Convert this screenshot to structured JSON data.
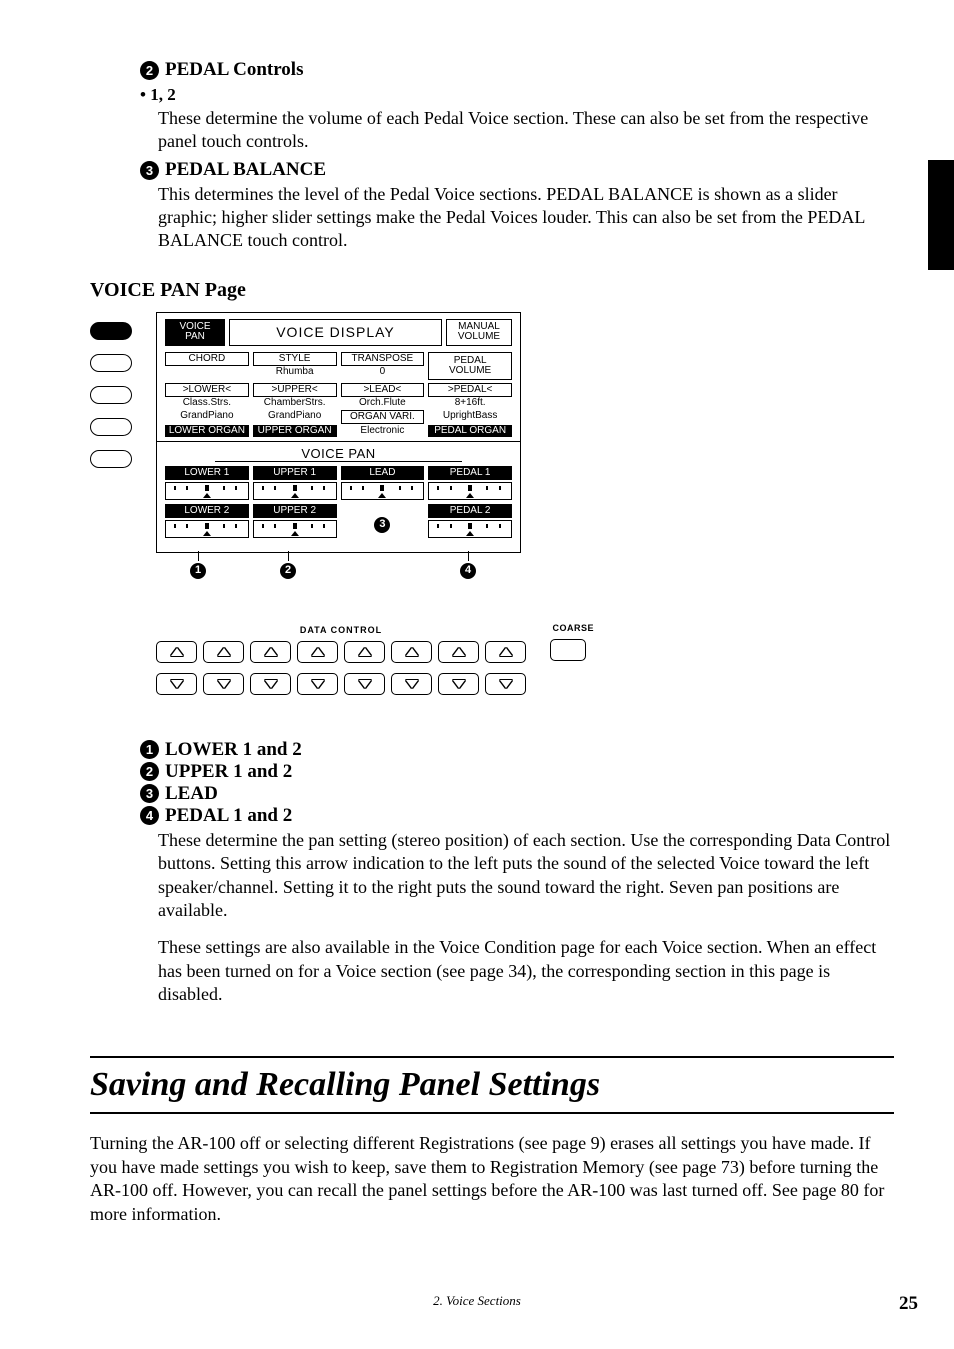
{
  "section_a": {
    "num": "2",
    "title": " PEDAL Controls",
    "bullet": "• 1, 2",
    "para": "These determine the volume of each Pedal Voice section.  These can also be set from the respective panel touch controls."
  },
  "section_b": {
    "num": "3",
    "title": " PEDAL BALANCE",
    "para": "This determines the level of the Pedal Voice sections.  PEDAL BALANCE is shown as a slider graphic; higher slider settings make the Pedal Voices louder.  This can also be set from the PEDAL BALANCE touch control."
  },
  "voice_pan_heading": "VOICE PAN Page",
  "lcd": {
    "voice_pan_tab": "VOICE\nPAN",
    "voice_display": "VOICE DISPLAY",
    "manual_volume": "MANUAL\nVOLUME",
    "row2": [
      "CHORD",
      "STYLE",
      "TRANSPOSE",
      ""
    ],
    "row2v": [
      "",
      "Rhumba",
      "0",
      "PEDAL\nVOLUME"
    ],
    "row3": [
      ">LOWER<",
      ">UPPER<",
      ">LEAD<",
      ">PEDAL<"
    ],
    "row3v": [
      "Class.Strs.",
      "ChamberStrs.",
      "Orch.Flute",
      "8+16ft."
    ],
    "row4v": [
      "GrandPiano",
      "GrandPiano",
      "ORGAN VARI.",
      "UprightBass"
    ],
    "row5v": [
      "LOWER ORGAN",
      "UPPER ORGAN",
      "Electronic",
      "PEDAL ORGAN"
    ],
    "pan_title": "VOICE PAN",
    "pan_r1": [
      "LOWER 1",
      "UPPER 1",
      "LEAD",
      "PEDAL 1"
    ],
    "pan_r2": [
      "LOWER 2",
      "UPPER 2",
      "",
      "PEDAL 2"
    ]
  },
  "callouts": {
    "c1": "1",
    "c2": "2",
    "c3": "3",
    "c4": "4"
  },
  "data_control_label": "DATA CONTROL",
  "coarse_label": "COARSE",
  "captions": {
    "c1n": "1",
    "c1t": " LOWER 1 and 2",
    "c2n": "2",
    "c2t": " UPPER 1 and 2",
    "c3n": "3",
    "c3t": " LEAD",
    "c4n": "4",
    "c4t": " PEDAL 1 and 2",
    "para1": "These determine the pan setting (stereo position) of each section.  Use the corresponding Data Control buttons.  Setting this arrow indication to the left puts the sound of the selected Voice toward the left speaker/channel.  Setting it to the right puts the sound toward the right.  Seven pan positions are available.",
    "para2": "These settings are also available in the Voice Condition page for each Voice section.  When an effect has been turned on for a Voice section (see page 34), the corresponding section in this page is disabled."
  },
  "big_heading": "Saving and Recalling Panel Settings",
  "final_para": "Turning the AR-100 off or selecting different Registrations (see page 9) erases all settings you have made.  If you have made settings you wish to keep, save them to Registration Memory (see page 73) before turning the AR-100 off.  However, you can recall the panel settings before the AR-100 was last turned off.  See page 80 for more information.",
  "footer_center": "2.  Voice Sections",
  "footer_page": "25"
}
